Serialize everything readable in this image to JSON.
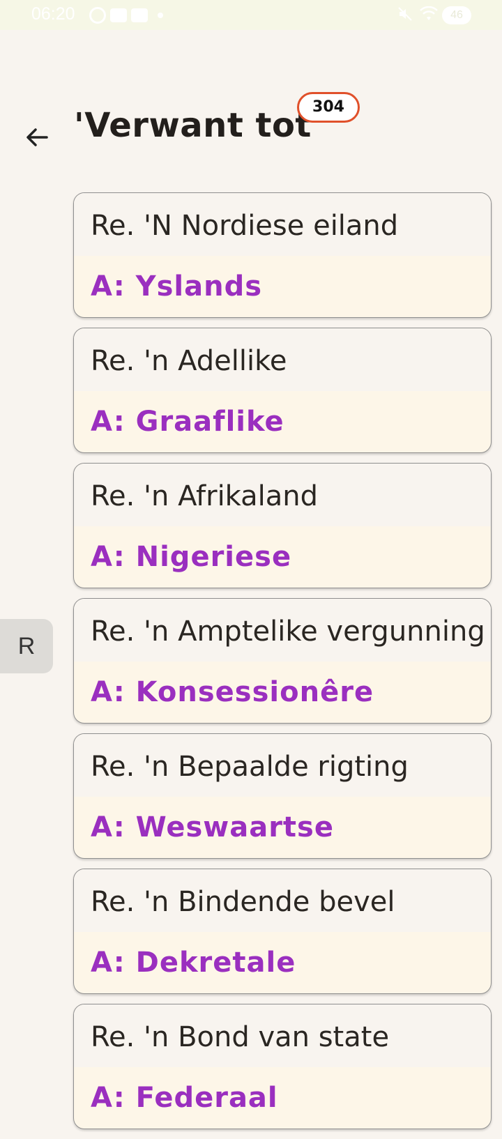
{
  "status_bar": {
    "time": "06:20",
    "battery": "46"
  },
  "header": {
    "title": "'Verwant tot'",
    "count": "304"
  },
  "side_index": {
    "letter": "R"
  },
  "cards": [
    {
      "question": "Re. 'N Nordiese eiland",
      "answer": "A: Yslands"
    },
    {
      "question": "Re. 'n Adellike",
      "answer": "A: Graaflike"
    },
    {
      "question": "Re. 'n Afrikaland",
      "answer": "A: Nigeriese"
    },
    {
      "question": "Re. 'n Amptelike vergunning",
      "answer": "A: Konsessionêre"
    },
    {
      "question": "Re. 'n Bepaalde rigting",
      "answer": "A: Weswaartse"
    },
    {
      "question": "Re. 'n Bindende bevel",
      "answer": "A: Dekretale"
    },
    {
      "question": "Re. 'n Bond van state",
      "answer": "A: Federaal"
    }
  ]
}
